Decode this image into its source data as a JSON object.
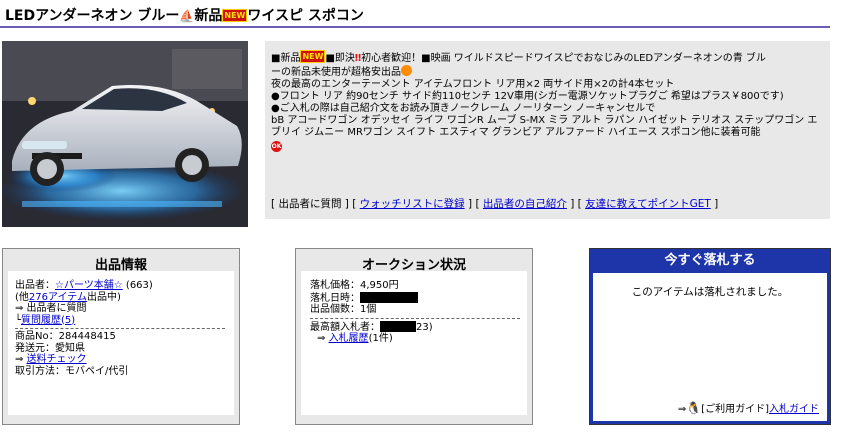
{
  "title": {
    "part1": "LEDアンダーネオン ブルー",
    "part2": "新品",
    "new_badge": "NEW",
    "part3": "ワイスピ スポコン"
  },
  "description": {
    "lines": [
      "■新品",
      "■即決",
      "初心者歓迎！■映画 ワイルドスピードワイスピでおなじみのLEDアンダーネオンの青 ブル",
      "ーの新品未使用が超格安出品",
      "夜の最高のエンターテーメント アイテムフロント リア用×2 両サイド用×2の計4本セット",
      "●フロント リア 約90センチ サイド約110センチ 12V車用(シガー電源ソケットプラグご 希望はプラス￥800です)",
      "●ご入札の際は自己紹介文をお読み頂きノークレーム ノーリターン ノーキャンセルで",
      "bB アコードワゴン オデッセイ ライフ ワゴンR ムーブ S-MX ミラ アルト ラパン ハイゼット テリオス ステップワゴン エブリイ ジムニー MRワゴン スイフト エスティマ グランビア アルファード ハイエース スポコン他に装着可能"
    ],
    "ok_badge": "OK",
    "links": {
      "open": "[",
      "question": "出品者に質問",
      "sep": "] [",
      "watchlist": "ウォッチリストに登録",
      "intro": "出品者の自己紹介",
      "tell_friend": "友達に教えてポイントGET",
      "close": "]"
    }
  },
  "seller_panel": {
    "title": "出品情報",
    "seller_label": "出品者：",
    "seller_name": "☆パーツ本舗☆",
    "seller_score": "(663)",
    "other_prefix": "(他",
    "other_link": "276アイテム",
    "other_suffix": "出品中)",
    "ask": "⇒ 出品者に質問",
    "history_prefix": "└",
    "history_link": "質問履歴(5)",
    "item_no": "商品No：284448415",
    "ship_from": "発送元：愛知県",
    "shipping_prefix": "⇒ ",
    "shipping_link": "送料チェック",
    "payment": "取引方法：モバペイ/代引"
  },
  "auction_panel": {
    "title": "オークション状況",
    "price": "落札価格：4,950円",
    "date_label": "落札日時：",
    "quantity": "出品個数：1個",
    "top_bidder_label": "最高額入札者：",
    "top_bidder_suffix": "23)",
    "history_prefix": "⇒ ",
    "history_link": "入札履歴",
    "history_count": "(1件)"
  },
  "buy_panel": {
    "title": "今すぐ落札する",
    "message": "このアイテムは落札されました。",
    "guide_prefix": "⇒",
    "guide_text": "[ご利用ガイド]",
    "guide_link": "入札ガイド"
  },
  "colors": {
    "accent": "#6b5fb5",
    "buy_panel": "#1d35a8",
    "link": "#0000cc",
    "panel_bg": "#e8e8e8"
  }
}
